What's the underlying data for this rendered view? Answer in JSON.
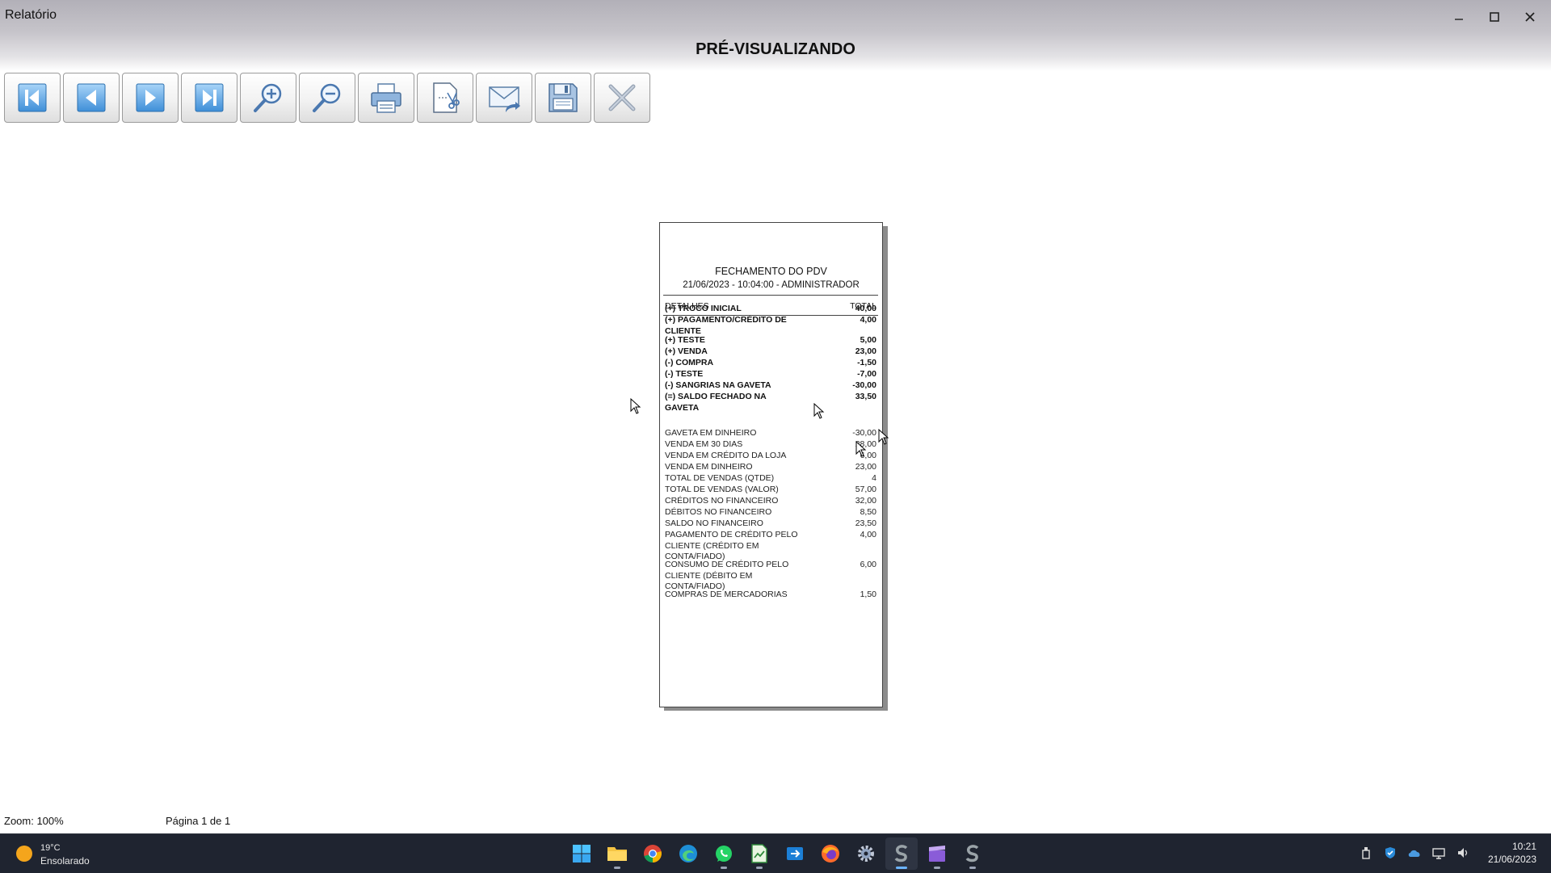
{
  "window": {
    "title": "Relatório",
    "minimize_icon": "minimize-icon",
    "maximize_icon": "maximize-icon",
    "close_icon": "close-icon"
  },
  "header": {
    "title": "PRÉ-VISUALIZANDO"
  },
  "toolbar": {
    "buttons": [
      {
        "name": "first-page-button",
        "icon": "first-page-icon"
      },
      {
        "name": "previous-page-button",
        "icon": "previous-page-icon"
      },
      {
        "name": "next-page-button",
        "icon": "next-page-icon"
      },
      {
        "name": "last-page-button",
        "icon": "last-page-icon"
      },
      {
        "name": "zoom-in-button",
        "icon": "zoom-in-icon"
      },
      {
        "name": "zoom-out-button",
        "icon": "zoom-out-icon"
      },
      {
        "name": "print-button",
        "icon": "printer-icon"
      },
      {
        "name": "page-setup-button",
        "icon": "page-setup-icon"
      },
      {
        "name": "email-button",
        "icon": "email-forward-icon"
      },
      {
        "name": "save-button",
        "icon": "floppy-disk-icon"
      },
      {
        "name": "close-preview-button",
        "icon": "close-icon"
      }
    ]
  },
  "report": {
    "title": "FECHAMENTO DO PDV",
    "subtitle": "21/06/2023 - 10:04:00 - ADMINISTRADOR",
    "col_details": "DETALHES",
    "col_total": "TOTAL",
    "summary": [
      {
        "label": "(+) TROCO INICIAL",
        "value": "40,00"
      },
      {
        "label": "(+) PAGAMENTO/CRÉDITO DE CLIENTE",
        "value": "4,00"
      },
      {
        "label": "(+) TESTE",
        "value": "5,00"
      },
      {
        "label": "(+) VENDA",
        "value": "23,00"
      },
      {
        "label": "(-) COMPRA",
        "value": "-1,50"
      },
      {
        "label": "(-) TESTE",
        "value": "-7,00"
      },
      {
        "label": "(-) SANGRIAS NA GAVETA",
        "value": "-30,00"
      },
      {
        "label": "(=) SALDO FECHADO NA GAVETA",
        "value": "33,50"
      }
    ],
    "details": [
      {
        "label": "GAVETA EM DINHEIRO",
        "value": "-30,00"
      },
      {
        "label": "VENDA EM 30 DIAS",
        "value": "28,00"
      },
      {
        "label": "VENDA EM CRÉDITO DA LOJA",
        "value": "6,00"
      },
      {
        "label": "VENDA EM DINHEIRO",
        "value": "23,00"
      },
      {
        "label": "TOTAL DE VENDAS (QTDE)",
        "value": "4"
      },
      {
        "label": "TOTAL DE VENDAS (VALOR)",
        "value": "57,00"
      },
      {
        "label": "CRÉDITOS NO FINANCEIRO",
        "value": "32,00"
      },
      {
        "label": "DÉBITOS NO FINANCEIRO",
        "value": "8,50"
      },
      {
        "label": "SALDO NO FINANCEIRO",
        "value": "23,50"
      },
      {
        "label": "PAGAMENTO DE CRÉDITO PELO CLIENTE (CRÉDITO EM CONTA/FIADO)",
        "value": "4,00"
      },
      {
        "label": "CONSUMO DE CRÉDITO PELO CLIENTE (DÉBITO EM CONTA/FIADO)",
        "value": "6,00"
      },
      {
        "label": "COMPRAS DE MERCADORIAS",
        "value": "1,50"
      }
    ]
  },
  "status": {
    "zoom": "Zoom: 100%",
    "page": "Página 1 de 1"
  },
  "taskbar": {
    "weather_temp": "19°C",
    "weather_condition": "Ensolarado",
    "apps": [
      {
        "name": "start-button",
        "icon": "windows-icon",
        "active": false
      },
      {
        "name": "file-explorer-button",
        "icon": "folder-icon",
        "active": false
      },
      {
        "name": "chrome-button",
        "icon": "chrome-icon",
        "active": false
      },
      {
        "name": "edge-button",
        "icon": "edge-icon",
        "active": false
      },
      {
        "name": "whatsapp-button",
        "icon": "whatsapp-icon",
        "active": false
      },
      {
        "name": "spreadsheet-button",
        "icon": "spreadsheet-icon",
        "active": false
      },
      {
        "name": "remote-app-button",
        "icon": "remote-icon",
        "active": false
      },
      {
        "name": "firefox-button",
        "icon": "firefox-icon",
        "active": false
      },
      {
        "name": "settings-button",
        "icon": "gear-icon",
        "active": false
      },
      {
        "name": "erp-app-button",
        "icon": "erp-s-icon",
        "active": true
      },
      {
        "name": "video-app-button",
        "icon": "clapper-icon",
        "active": false
      },
      {
        "name": "erp-app-2-button",
        "icon": "erp-s-icon",
        "active": false
      }
    ],
    "time": "10:21",
    "date": "21/06/2023"
  }
}
